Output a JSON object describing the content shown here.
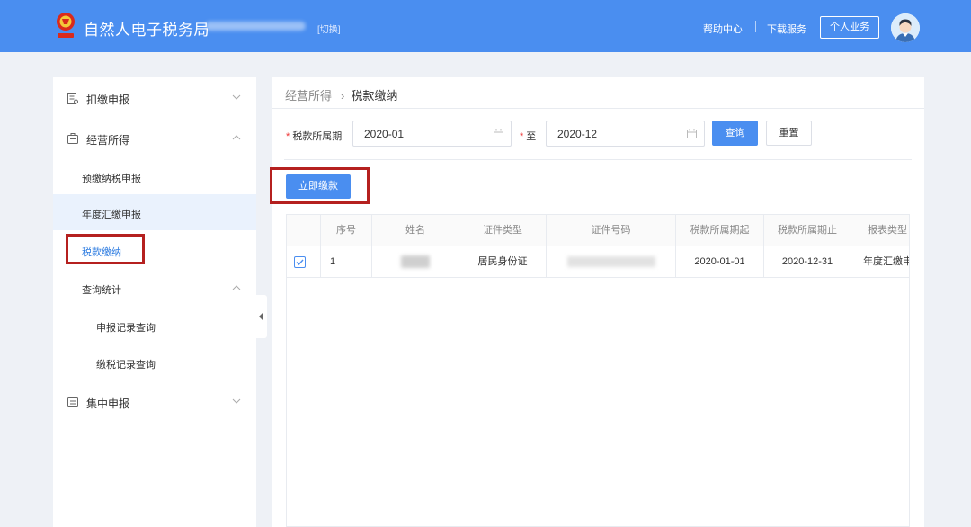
{
  "header": {
    "app_title": "自然人电子税务局",
    "switch_label": "[切换]",
    "help_center": "帮助中心",
    "download_service": "下载服务",
    "personal_business": "个人业务"
  },
  "sidebar": {
    "items": [
      {
        "label": "扣缴申报",
        "icon": "form-icon",
        "expanded": false
      },
      {
        "label": "经营所得",
        "icon": "business-icon",
        "expanded": true
      },
      {
        "label": "集中申报",
        "icon": "list-icon",
        "expanded": false
      }
    ],
    "business_sub": [
      "预缴纳税申报",
      "年度汇缴申报",
      "税款缴纳"
    ],
    "query_group": {
      "label": "查询统计",
      "expanded": true
    },
    "query_sub": [
      "申报记录查询",
      "缴税记录查询"
    ],
    "active": "税款缴纳"
  },
  "breadcrumb": {
    "parent": "经营所得",
    "current": "税款缴纳"
  },
  "filter": {
    "period_label": "税款所属期",
    "from_value": "2020-01",
    "to_label": "至",
    "to_value": "2020-12",
    "query_button": "查询",
    "reset_button": "重置"
  },
  "pay_button": "立即缴款",
  "table": {
    "columns": [
      "序号",
      "姓名",
      "证件类型",
      "证件号码",
      "税款所属期起",
      "税款所属期止",
      "报表类型"
    ],
    "rows": [
      {
        "checked": true,
        "index": "1",
        "name": "",
        "id_type": "居民身份证",
        "id_number": "",
        "start": "2020-01-01",
        "end": "2020-12-31",
        "report_type": "年度汇缴申报"
      }
    ]
  },
  "colors": {
    "primary": "#4a8ef0",
    "highlight": "#b5201f",
    "required": "#e33"
  }
}
